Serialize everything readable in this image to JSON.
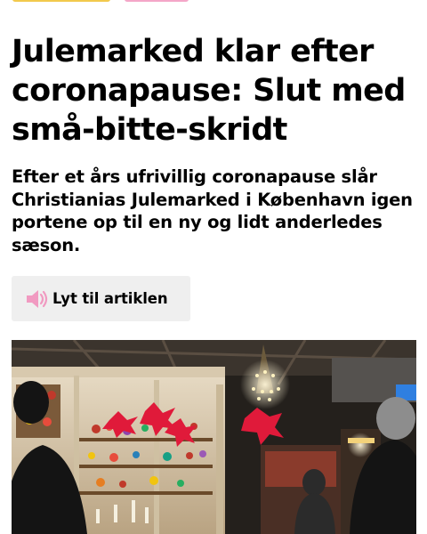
{
  "article": {
    "headline": "Julemarked klar efter coronapause: Slut med små-bitte-skridt",
    "subheadline": "Efter et års ufrivillig coronapause slår Christianias Julemarked i København igen portene op til en ny og lidt anderledes sæson.",
    "listen_button": {
      "label": "Lyt til artiklen",
      "icon": "speaker-icon"
    }
  },
  "colors": {
    "category_tag_1": "#f2c94c",
    "category_tag_2": "#f4a6c8",
    "speaker_icon": "#f19ac1",
    "button_bg": "#efefef"
  }
}
